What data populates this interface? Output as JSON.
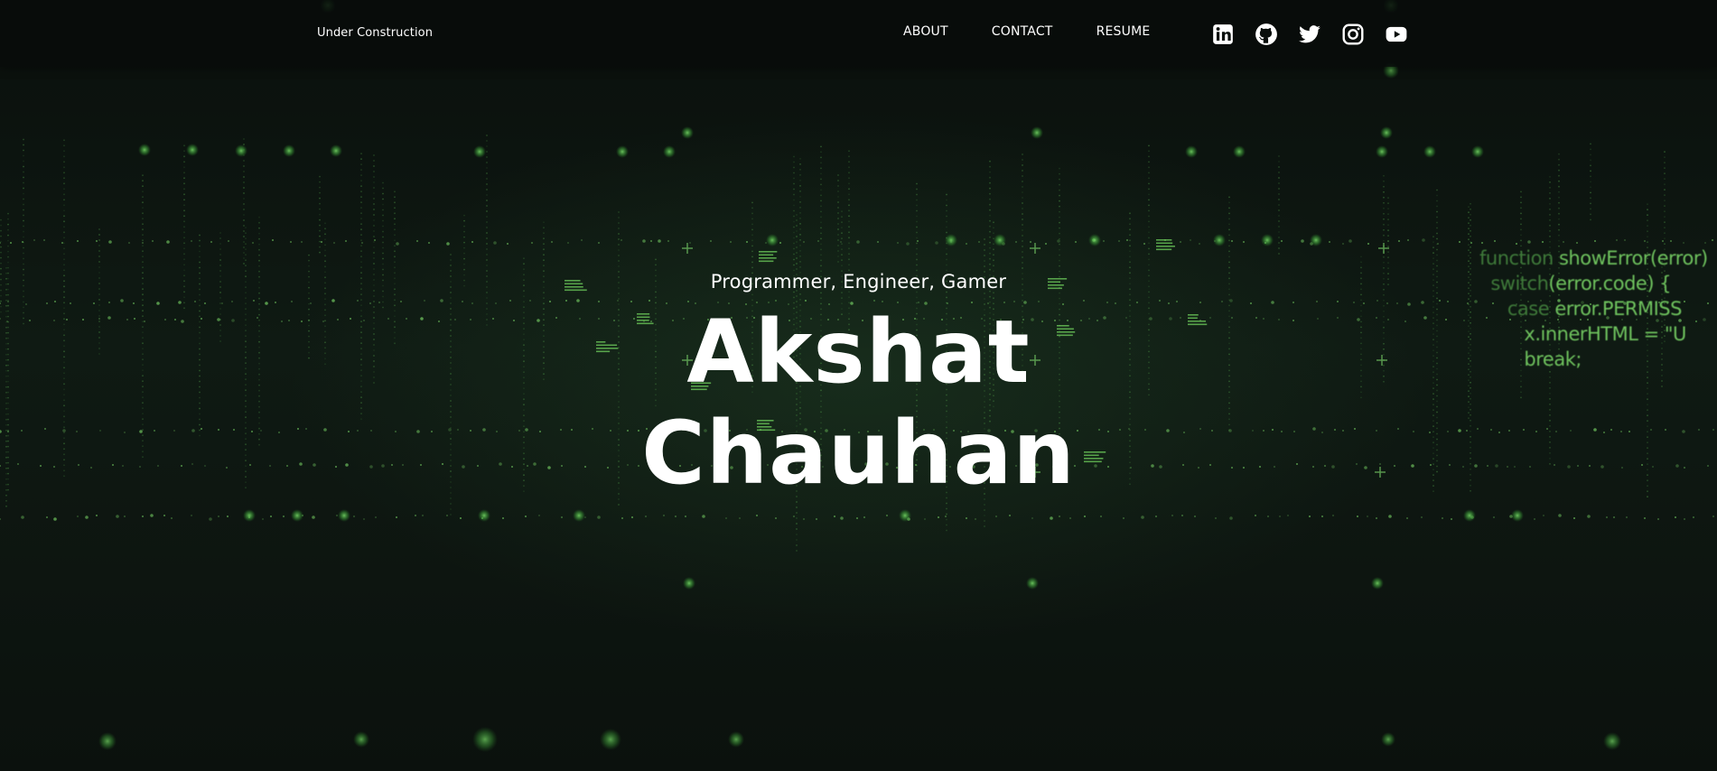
{
  "header": {
    "brand": "Under Construction",
    "nav": [
      {
        "label": "ABOUT"
      },
      {
        "label": "CONTACT"
      },
      {
        "label": "RESUME"
      }
    ],
    "social": [
      {
        "icon": "linkedin-icon"
      },
      {
        "icon": "github-icon"
      },
      {
        "icon": "twitter-icon"
      },
      {
        "icon": "instagram-icon"
      },
      {
        "icon": "youtube-icon"
      }
    ]
  },
  "hero": {
    "subtitle": "Programmer, Engineer, Gamer",
    "first_name": "Akshat",
    "last_name": "Chauhan"
  },
  "background_code": {
    "line1_kw": "function",
    "line1_rest": " showError(error)",
    "line2_kw": "switch",
    "line2_rest": "(error.code) {",
    "line3_kw": "case",
    "line3_rest": " error.PERMISS",
    "line4": "x.innerHTML = \"U",
    "line5": "break;"
  },
  "colors": {
    "accent_green": "#5cc44f",
    "text": "#ffffff",
    "background": "#0c120f"
  }
}
